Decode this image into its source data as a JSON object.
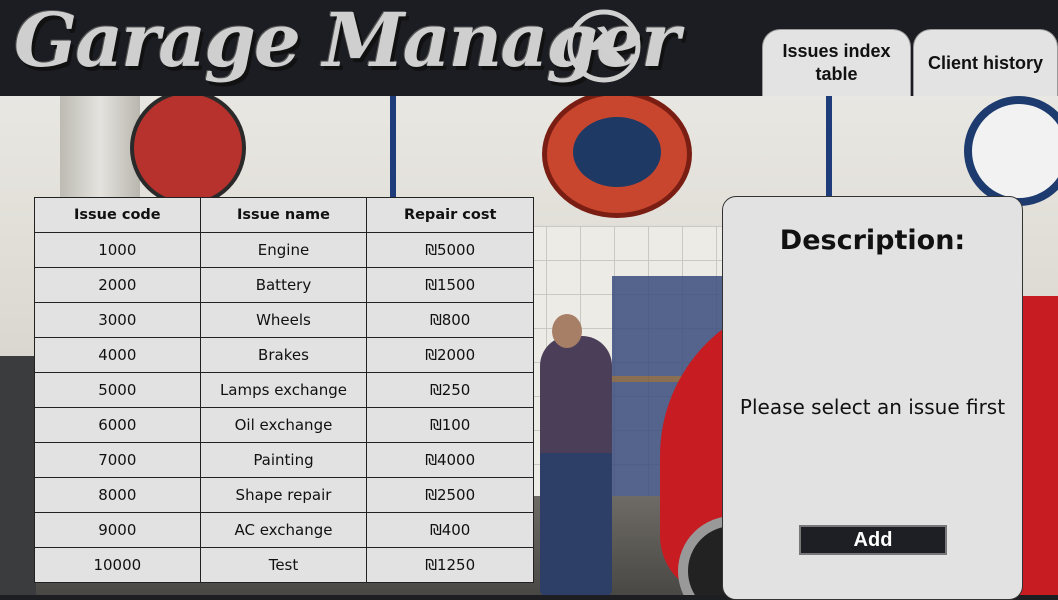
{
  "header": {
    "logo_text": "Garage Manager",
    "logo_icon": "wrench-icon",
    "tabs": [
      {
        "label": "Issues index table"
      },
      {
        "label": "Client history"
      }
    ]
  },
  "issues_table": {
    "columns": [
      "Issue code",
      "Issue name",
      "Repair cost"
    ],
    "rows": [
      [
        "1000",
        "Engine",
        "₪5000"
      ],
      [
        "2000",
        "Battery",
        "₪1500"
      ],
      [
        "3000",
        "Wheels",
        "₪800"
      ],
      [
        "4000",
        "Brakes",
        "₪2000"
      ],
      [
        "5000",
        "Lamps exchange",
        "₪250"
      ],
      [
        "6000",
        "Oil exchange",
        "₪100"
      ],
      [
        "7000",
        "Painting",
        "₪4000"
      ],
      [
        "8000",
        "Shape repair",
        "₪2500"
      ],
      [
        "9000",
        "AC exchange",
        "₪400"
      ],
      [
        "10000",
        "Test",
        "₪1250"
      ]
    ]
  },
  "description_panel": {
    "title": "Description:",
    "placeholder_text": "Please select an issue first",
    "add_label": "Add"
  },
  "colors": {
    "header_bg": "#1c1d22",
    "panel_bg": "#e2e2e2",
    "button_bg": "#1e1f24"
  }
}
